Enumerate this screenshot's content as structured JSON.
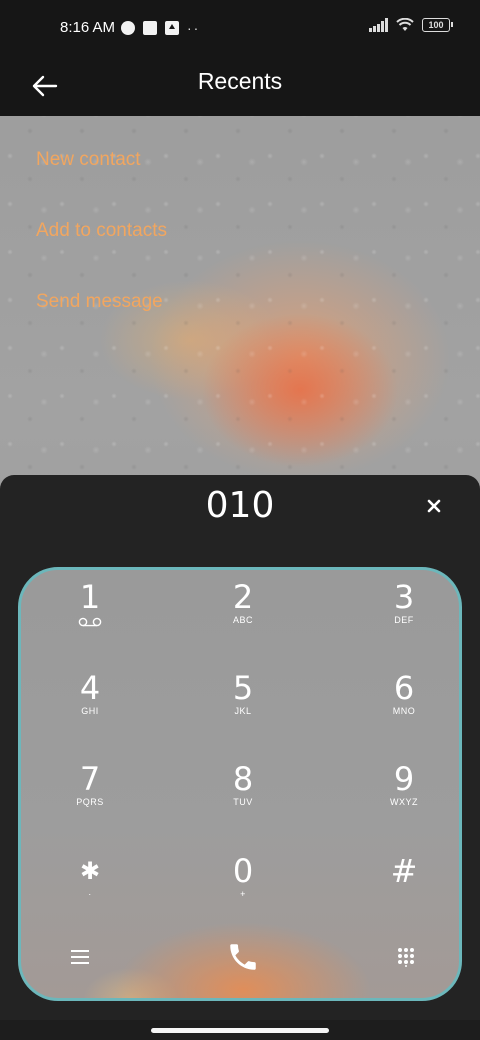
{
  "status_bar": {
    "time": "8:16 AM",
    "battery": "100",
    "left_icons": [
      "data-saver-icon",
      "square-notification-icon",
      "upload-icon"
    ],
    "more_indicator": "··"
  },
  "app_bar": {
    "back_icon": "arrow-left-icon",
    "title": "Recents"
  },
  "actions": [
    {
      "label": "New contact"
    },
    {
      "label": "Add to contacts"
    },
    {
      "label": "Send message"
    }
  ],
  "accent_color": "#f2a65f",
  "keypad_border_color": "#6cb7bb",
  "dialer": {
    "number": "010",
    "clear_icon": "close-icon",
    "keys": [
      {
        "digit": "1",
        "letters": "",
        "sub_icon": "voicemail-icon"
      },
      {
        "digit": "2",
        "letters": "ABC"
      },
      {
        "digit": "3",
        "letters": "DEF"
      },
      {
        "digit": "4",
        "letters": "GHI"
      },
      {
        "digit": "5",
        "letters": "JKL"
      },
      {
        "digit": "6",
        "letters": "MNO"
      },
      {
        "digit": "7",
        "letters": "PQRS"
      },
      {
        "digit": "8",
        "letters": "TUV"
      },
      {
        "digit": "9",
        "letters": "WXYZ"
      },
      {
        "digit": "✱",
        "letters": "·"
      },
      {
        "digit": "0",
        "letters": "+"
      },
      {
        "digit": "#",
        "letters": ""
      }
    ],
    "bottom_icons": [
      "menu-icon",
      "phone-call-icon",
      "keypad-grid-icon"
    ]
  }
}
